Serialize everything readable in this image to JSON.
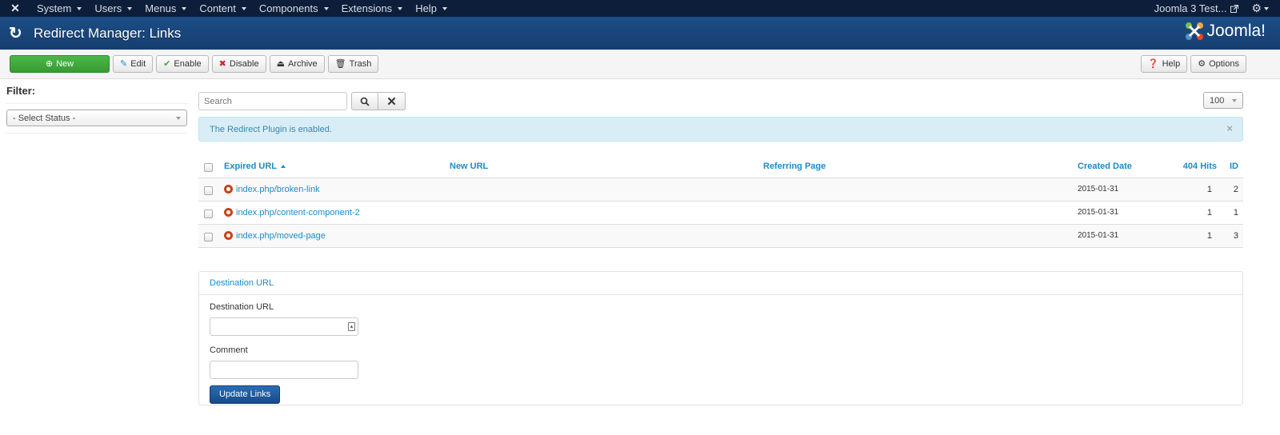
{
  "navbar": {
    "menus": [
      "System",
      "Users",
      "Menus",
      "Content",
      "Components",
      "Extensions",
      "Help"
    ],
    "site_name": "Joomla 3 Test...",
    "logo_icon": "joomla-icon",
    "gear_icon": "gear-icon"
  },
  "header": {
    "title": "Redirect Manager: Links",
    "brand": "Joomla!"
  },
  "toolbar": {
    "new": "New",
    "edit": "Edit",
    "enable": "Enable",
    "disable": "Disable",
    "archive": "Archive",
    "trash": "Trash",
    "help": "Help",
    "options": "Options"
  },
  "sidebar": {
    "filter_label": "Filter:",
    "status_select": "- Select Status -"
  },
  "search": {
    "placeholder": "Search",
    "value": ""
  },
  "list_limit": "100",
  "alert": {
    "message": "The Redirect Plugin is enabled.",
    "close": "×"
  },
  "table": {
    "columns": {
      "expired_url": "Expired URL",
      "new_url": "New URL",
      "referring_page": "Referring Page",
      "created_date": "Created Date",
      "hits": "404 Hits",
      "id": "ID"
    },
    "rows": [
      {
        "expired_url": "index.php/broken-link",
        "new_url": "",
        "referring_page": "",
        "created_date": "2015-01-31",
        "hits": "1",
        "id": "2"
      },
      {
        "expired_url": "index.php/content-component-2",
        "new_url": "",
        "referring_page": "",
        "created_date": "2015-01-31",
        "hits": "1",
        "id": "1"
      },
      {
        "expired_url": "index.php/moved-page",
        "new_url": "",
        "referring_page": "",
        "created_date": "2015-01-31",
        "hits": "1",
        "id": "3"
      }
    ]
  },
  "batch_panel": {
    "title": "Destination URL",
    "destination_label": "Destination URL",
    "destination_value": "",
    "comment_label": "Comment",
    "comment_value": "",
    "submit": "Update Links"
  },
  "colors": {
    "navbar_bg": "#0d1e3a",
    "header_bg": "#1c4e86",
    "new_button": "#4cb848",
    "link": "#1a8cc8",
    "alert_bg": "#d9edf7",
    "status_unpublished": "#c8441a",
    "primary_button": "#2a6db5"
  }
}
